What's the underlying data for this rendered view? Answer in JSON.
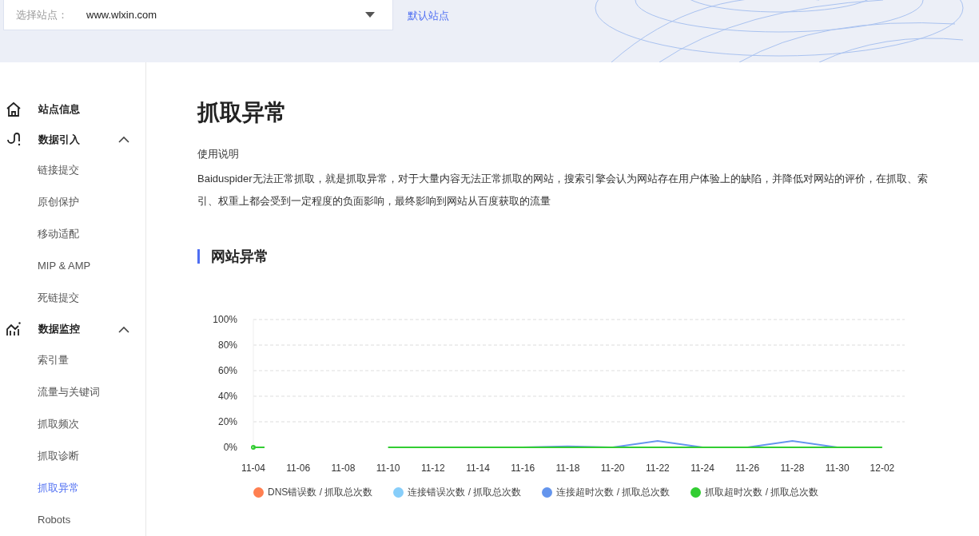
{
  "site_selector": {
    "label": "选择站点：",
    "value": "www.wlxin.com",
    "default_link": "默认站点"
  },
  "sidebar": {
    "items": [
      {
        "kind": "link",
        "label": "站点信息"
      },
      {
        "kind": "group",
        "label": "数据引入",
        "expanded": true,
        "children": [
          {
            "label": "链接提交",
            "selected": false
          },
          {
            "label": "原创保护",
            "selected": false
          },
          {
            "label": "移动适配",
            "selected": false
          },
          {
            "label": "MIP & AMP",
            "selected": false
          },
          {
            "label": "死链提交",
            "selected": false
          }
        ]
      },
      {
        "kind": "group",
        "label": "数据监控",
        "expanded": true,
        "children": [
          {
            "label": "索引量",
            "selected": false
          },
          {
            "label": "流量与关键词",
            "selected": false
          },
          {
            "label": "抓取频次",
            "selected": false
          },
          {
            "label": "抓取诊断",
            "selected": false
          },
          {
            "label": "抓取异常",
            "selected": true
          },
          {
            "label": "Robots",
            "selected": false
          }
        ]
      }
    ]
  },
  "page": {
    "title": "抓取异常",
    "usage_heading": "使用说明",
    "description": "Baiduspider无法正常抓取，就是抓取异常，对于大量内容无法正常抓取的网站，搜索引擎会认为网站存在用户体验上的缺陷，并降低对网站的评价，在抓取、索引、权重上都会受到一定程度的负面影响，最终影响到网站从百度获取的流量",
    "section_title": "网站异常"
  },
  "chart_data": {
    "type": "line",
    "categories": [
      "11-04",
      "11-06",
      "11-08",
      "11-10",
      "11-12",
      "11-14",
      "11-16",
      "11-18",
      "11-20",
      "11-22",
      "11-24",
      "11-26",
      "11-28",
      "11-30",
      "12-02"
    ],
    "grid": true,
    "ylim": [
      0,
      100
    ],
    "yticks": [
      {
        "value": 0,
        "label": "0%"
      },
      {
        "value": 20,
        "label": "20%"
      },
      {
        "value": 40,
        "label": "40%"
      },
      {
        "value": 60,
        "label": "60%"
      },
      {
        "value": 80,
        "label": "80%"
      },
      {
        "value": 100,
        "label": "100%"
      }
    ],
    "series": [
      {
        "name": "DNS错误数 / 抓取总次数",
        "color": "#ff7f50",
        "values": [
          null,
          null,
          null,
          null,
          null,
          null,
          null,
          null,
          null,
          null,
          null,
          null,
          null,
          null,
          null
        ]
      },
      {
        "name": "连接错误次数 / 抓取总次数",
        "color": "#87cefa",
        "values": [
          null,
          null,
          null,
          null,
          null,
          null,
          null,
          null,
          null,
          null,
          null,
          null,
          null,
          null,
          null
        ]
      },
      {
        "name": "连接超时次数 / 抓取总次数",
        "color": "#6495ed",
        "values": [
          null,
          null,
          null,
          null,
          null,
          null,
          0,
          0.8,
          0,
          5,
          0,
          0,
          5,
          0,
          null
        ]
      },
      {
        "name": "抓取超时次数 / 抓取总次数",
        "color": "#32cd32",
        "values": [
          0,
          null,
          null,
          0,
          0,
          0,
          0,
          0,
          0,
          0,
          0,
          0,
          0,
          0,
          0
        ]
      }
    ]
  }
}
